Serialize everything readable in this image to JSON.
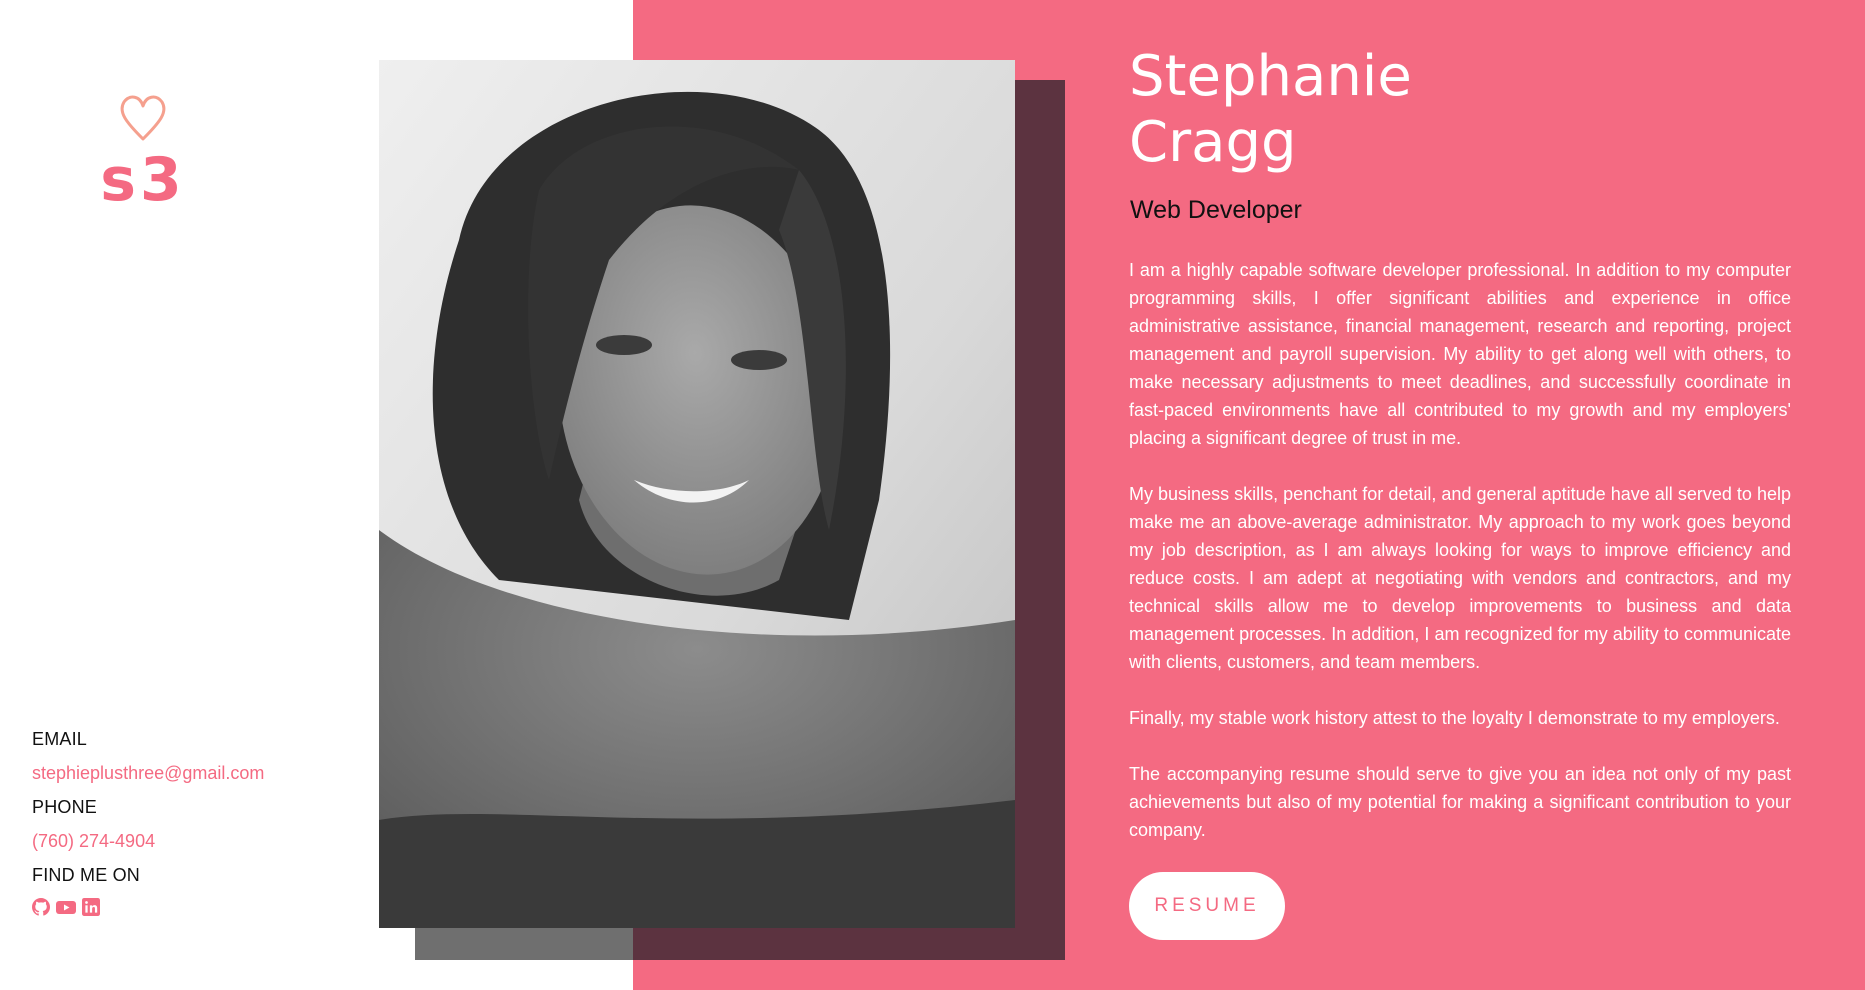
{
  "brand": {
    "logo_text": "s3",
    "icon": "heart-icon",
    "accent_color": "#f46a82"
  },
  "contact": {
    "email_label": "EMAIL",
    "email": "stephieplusthree@gmail.com",
    "phone_label": "PHONE",
    "phone": "(760) 274-4904",
    "find_label": "FIND ME ON",
    "socials": [
      "github-icon",
      "youtube-icon",
      "linkedin-icon"
    ]
  },
  "profile": {
    "name_line1": "Stephanie",
    "name_line2": "Cragg",
    "role": "Web Developer",
    "bio": [
      "I am a highly capable software developer professional. In addition to my computer programming skills, I offer significant abilities and experience in office administrative assistance, financial management, research and reporting, project management and payroll supervision. My ability to get along well with others, to make necessary adjustments to meet deadlines, and successfully coordinate in fast-paced environments have all contributed to my growth and my employers' placing a significant degree of trust in me.",
      "My business skills, penchant for detail, and general aptitude have all served to help make me an above-average administrator. My approach to my work goes beyond my job description, as I am always looking for ways to improve efficiency and reduce costs. I am adept at negotiating with vendors and contractors, and my technical skills allow me to develop improvements to business and data management processes. In addition, I am recognized for my ability to communicate with clients, customers, and team members.",
      "Finally, my stable work history attest to the loyalty I demonstrate to my employers.",
      "The accompanying resume should serve to give you an idea not only of my past achievements but also of my potential for making a significant contribution to your company."
    ],
    "resume_label": "RESUME"
  }
}
